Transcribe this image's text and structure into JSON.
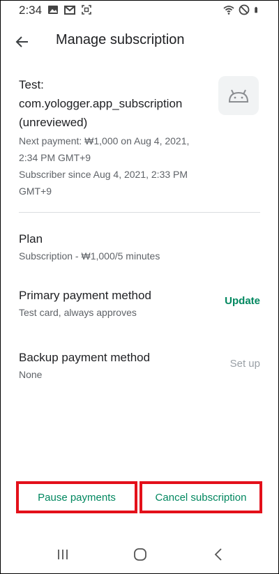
{
  "status_bar": {
    "time": "2:34",
    "left_icons": [
      "image-icon",
      "gmail-icon",
      "screenshot-icon"
    ],
    "right_icons": [
      "wifi-icon",
      "do-not-disturb-icon",
      "battery-icon"
    ]
  },
  "header": {
    "title": "Manage subscription",
    "back_icon": "arrow-back-icon"
  },
  "product": {
    "name_line1": "Test:",
    "name_line2": "com.yologger.app_subscription",
    "name_line3": "(unreviewed)",
    "next_payment": "Next payment: ₩1,000 on Aug 4, 2021, 2:34 PM GMT+9",
    "subscriber_since": "Subscriber since Aug 4, 2021, 2:33 PM GMT+9",
    "icon": "android-icon"
  },
  "plan": {
    "title": "Plan",
    "detail": "Subscription - ₩1,000/5 minutes"
  },
  "primary_payment": {
    "title": "Primary payment method",
    "detail": "Test card, always approves",
    "action": "Update"
  },
  "backup_payment": {
    "title": "Backup payment method",
    "detail": "None",
    "action": "Set up"
  },
  "actions": {
    "pause": "Pause payments",
    "cancel": "Cancel subscription"
  },
  "nav_bar": [
    "recents-icon",
    "home-icon",
    "back-icon"
  ],
  "colors": {
    "accent_green": "#01875f",
    "highlight_red": "#e3101a",
    "secondary_text": "#5f6368"
  }
}
